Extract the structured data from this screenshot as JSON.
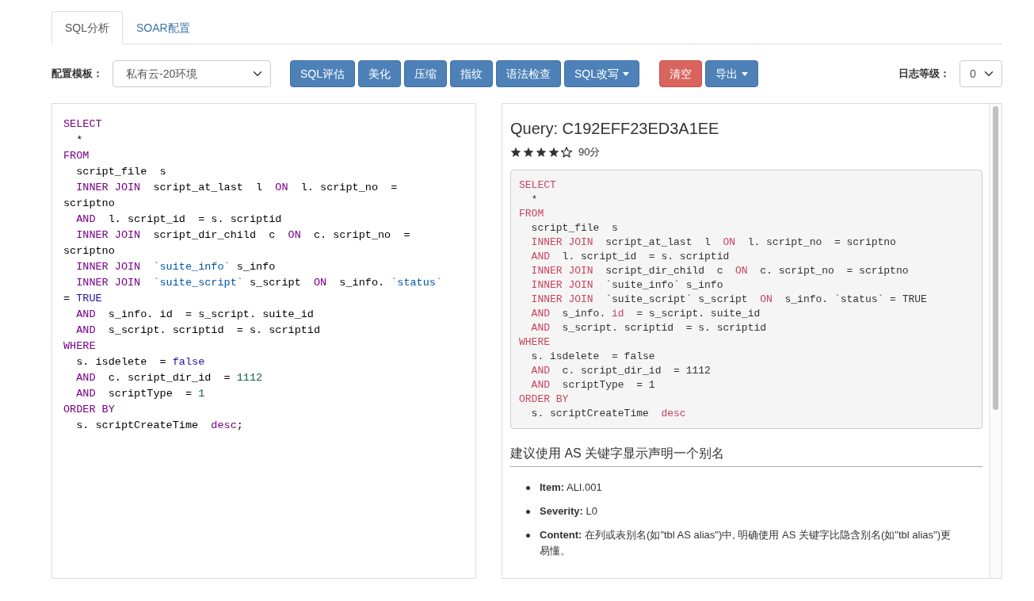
{
  "tabs": [
    {
      "label": "SQL分析",
      "selected": true
    },
    {
      "label": "SOAR配置",
      "selected": false
    }
  ],
  "toolbar": {
    "template_label": "配置模板：",
    "template_select": {
      "value": "私有云-20环境"
    },
    "button_groups": [
      [
        {
          "label": "SQL评估",
          "kind": "primary",
          "dropdown": false
        },
        {
          "label": "美化",
          "kind": "primary",
          "dropdown": false
        },
        {
          "label": "压缩",
          "kind": "primary",
          "dropdown": false
        },
        {
          "label": "指纹",
          "kind": "primary",
          "dropdown": false
        },
        {
          "label": "语法检查",
          "kind": "primary",
          "dropdown": false
        },
        {
          "label": "SQL改写",
          "kind": "primary",
          "dropdown": true
        }
      ],
      [
        {
          "label": "清空",
          "kind": "danger",
          "dropdown": false
        },
        {
          "label": "导出",
          "kind": "primary",
          "dropdown": true
        }
      ]
    ],
    "log_level_label": "日志等级：",
    "log_level_select": {
      "value": "0"
    }
  },
  "editor": {
    "lines": [
      [
        {
          "kind": "keyword",
          "text": "SELECT"
        }
      ],
      [
        {
          "kind": "plain",
          "text": "  *"
        }
      ],
      [
        {
          "kind": "keyword",
          "text": "FROM"
        }
      ],
      [
        {
          "kind": "plain",
          "text": "  script_file  s"
        }
      ],
      [
        {
          "kind": "keyword",
          "text": "  INNER JOIN"
        },
        {
          "kind": "plain",
          "text": "  script_at_last  l  "
        },
        {
          "kind": "keyword",
          "text": "ON"
        },
        {
          "kind": "plain",
          "text": "  l. script_no  = scriptno"
        }
      ],
      [
        {
          "kind": "keyword",
          "text": "  AND"
        },
        {
          "kind": "plain",
          "text": "  l. script_id  = s. scriptid"
        }
      ],
      [
        {
          "kind": "keyword",
          "text": "  INNER JOIN"
        },
        {
          "kind": "plain",
          "text": "  script_dir_child  c  "
        },
        {
          "kind": "keyword",
          "text": "ON"
        },
        {
          "kind": "plain",
          "text": "  c. script_no  = scriptno"
        }
      ],
      [
        {
          "kind": "keyword",
          "text": "  INNER JOIN  "
        },
        {
          "kind": "quoted",
          "text": "`suite_info`"
        },
        {
          "kind": "plain",
          "text": " s_info"
        }
      ],
      [
        {
          "kind": "keyword",
          "text": "  INNER JOIN  "
        },
        {
          "kind": "quoted",
          "text": "`suite_script`"
        },
        {
          "kind": "plain",
          "text": " s_script  "
        },
        {
          "kind": "keyword",
          "text": "ON"
        },
        {
          "kind": "plain",
          "text": "  s_info. "
        },
        {
          "kind": "quoted",
          "text": "`status`"
        },
        {
          "kind": "plain",
          "text": " = "
        },
        {
          "kind": "atom",
          "text": "TRUE"
        }
      ],
      [
        {
          "kind": "keyword",
          "text": "  AND"
        },
        {
          "kind": "plain",
          "text": "  s_info. id  = s_script. suite_id"
        }
      ],
      [
        {
          "kind": "keyword",
          "text": "  AND"
        },
        {
          "kind": "plain",
          "text": "  s_script. scriptid  = s. scriptid"
        }
      ],
      [
        {
          "kind": "keyword",
          "text": "WHERE"
        }
      ],
      [
        {
          "kind": "plain",
          "text": "  s. isdelete  = "
        },
        {
          "kind": "atom",
          "text": "false"
        }
      ],
      [
        {
          "kind": "keyword",
          "text": "  AND"
        },
        {
          "kind": "plain",
          "text": "  c. script_dir_id  = "
        },
        {
          "kind": "number",
          "text": "1112"
        }
      ],
      [
        {
          "kind": "keyword",
          "text": "  AND"
        },
        {
          "kind": "plain",
          "text": "  scriptType  = "
        },
        {
          "kind": "number",
          "text": "1"
        }
      ],
      [
        {
          "kind": "keyword",
          "text": "ORDER BY"
        }
      ],
      [
        {
          "kind": "plain",
          "text": "  s. scriptCreateTime  "
        },
        {
          "kind": "keyword",
          "text": "desc"
        },
        {
          "kind": "plain",
          "text": ";"
        }
      ]
    ]
  },
  "result": {
    "title": "Query: C192EFF23ED3A1EE",
    "stars": 4,
    "score": "90分",
    "code_lines": [
      [
        {
          "kind": "keyword",
          "text": "SELECT"
        }
      ],
      [
        {
          "kind": "plain",
          "text": "  *"
        }
      ],
      [
        {
          "kind": "keyword",
          "text": "FROM"
        }
      ],
      [
        {
          "kind": "plain",
          "text": "  script_file  s"
        }
      ],
      [
        {
          "kind": "keyword",
          "text": "  INNER JOIN"
        },
        {
          "kind": "plain",
          "text": "  script_at_last  l  "
        },
        {
          "kind": "keyword",
          "text": "ON"
        },
        {
          "kind": "plain",
          "text": "  l. script_no  = scriptno"
        }
      ],
      [
        {
          "kind": "keyword",
          "text": "  AND"
        },
        {
          "kind": "plain",
          "text": "  l. script_id  = s. scriptid"
        }
      ],
      [
        {
          "kind": "keyword",
          "text": "  INNER JOIN"
        },
        {
          "kind": "plain",
          "text": "  script_dir_child  c  "
        },
        {
          "kind": "keyword",
          "text": "ON"
        },
        {
          "kind": "plain",
          "text": "  c. script_no  = scriptno"
        }
      ],
      [
        {
          "kind": "keyword",
          "text": "  INNER JOIN"
        },
        {
          "kind": "plain",
          "text": "  `suite_info` s_info"
        }
      ],
      [
        {
          "kind": "keyword",
          "text": "  INNER JOIN"
        },
        {
          "kind": "plain",
          "text": "  `suite_script` s_script  "
        },
        {
          "kind": "keyword",
          "text": "ON"
        },
        {
          "kind": "plain",
          "text": "  s_info. `status` = TRUE"
        }
      ],
      [
        {
          "kind": "keyword",
          "text": "  AND"
        },
        {
          "kind": "plain",
          "text": "  s_info. "
        },
        {
          "kind": "keyword",
          "text": "id"
        },
        {
          "kind": "plain",
          "text": "  = s_script. suite_id"
        }
      ],
      [
        {
          "kind": "keyword",
          "text": "  AND"
        },
        {
          "kind": "plain",
          "text": "  s_script. scriptid  = s. scriptid"
        }
      ],
      [
        {
          "kind": "keyword",
          "text": "WHERE"
        }
      ],
      [
        {
          "kind": "plain",
          "text": "  s. isdelete  = false"
        }
      ],
      [
        {
          "kind": "keyword",
          "text": "  AND"
        },
        {
          "kind": "plain",
          "text": "  c. script_dir_id  = 1112"
        }
      ],
      [
        {
          "kind": "keyword",
          "text": "  AND"
        },
        {
          "kind": "plain",
          "text": "  scriptType  = 1"
        }
      ],
      [
        {
          "kind": "keyword",
          "text": "ORDER BY"
        }
      ],
      [
        {
          "kind": "plain",
          "text": "  s. scriptCreateTime  "
        },
        {
          "kind": "keyword",
          "text": "desc"
        }
      ]
    ],
    "advice": {
      "title": "建议使用 AS 关键字显示声明一个别名",
      "items": [
        "**Item:** ALI.001",
        "**Severity:** L0",
        "**Content:** 在列或表别名(如\"tbl AS alias\")中, 明确使用 AS 关键字比隐含别名(如\"tbl alias\")更易懂。"
      ]
    }
  }
}
